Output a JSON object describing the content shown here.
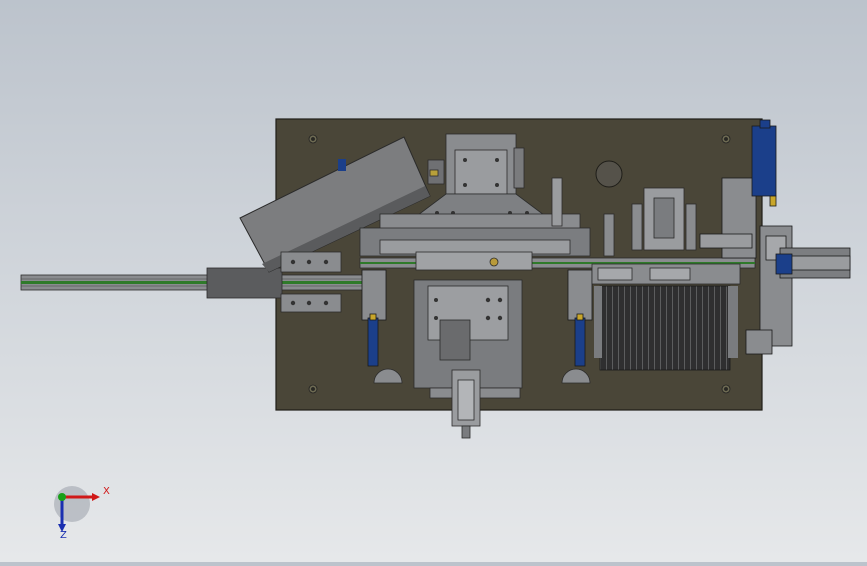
{
  "triad": {
    "x_label": "X",
    "z_label": "Z",
    "colors": {
      "x": "#d01818",
      "y": "#18a018",
      "z": "#1a2fb0"
    }
  },
  "colors": {
    "background_top": "#bcc3cc",
    "background_bottom": "#e6e8ea",
    "base_plate": "#4a4638",
    "machined_part": "#8a8c8f",
    "dark_part": "#3a3a3a",
    "cylinder_blue": "#1b3f8a",
    "rail_green": "#2f7a2a"
  }
}
